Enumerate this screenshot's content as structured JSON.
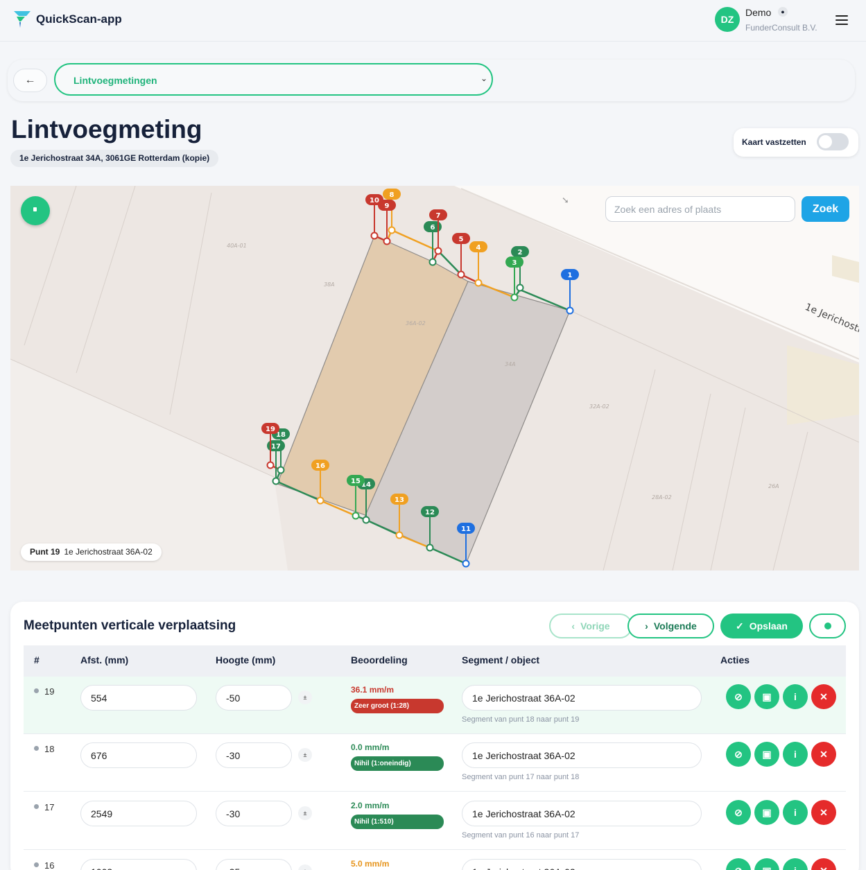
{
  "header": {
    "app_title": "QuickScan-app",
    "avatar_initials": "DZ",
    "user_name": "Demo",
    "user_org": "FunderConsult B.V."
  },
  "nav": {
    "back_label": "←",
    "selected_option": "Lintvoegmetingen"
  },
  "page": {
    "title": "Lintvoegmeting",
    "address": "1e Jerichostraat 34A, 3061GE Rotterdam (kopie)",
    "lock_map_label": "Kaart vastzetten",
    "lock_map_on": false
  },
  "map": {
    "search_placeholder": "Zoek een adres of plaats",
    "search_button": "Zoek",
    "street_label": "1e Jerichostr",
    "parcels": [
      "40A-01",
      "38A",
      "36A-02",
      "34A",
      "32A-02",
      "28A-02",
      "26A"
    ],
    "markers": [
      "1",
      "2",
      "3",
      "4",
      "5",
      "6",
      "7",
      "8",
      "9",
      "10",
      "11",
      "12",
      "13",
      "14",
      "15",
      "16",
      "17",
      "18",
      "19"
    ],
    "selected_point_label": "Punt 19",
    "selected_point_segment": "1e Jerichostraat 36A-02"
  },
  "panel": {
    "title": "Meetpunten verticale verplaatsing",
    "prev_label": "Vorige",
    "next_label": "Volgende",
    "save_label": "Opslaan",
    "columns": [
      "#",
      "Afst. (mm)",
      "Hoogte (mm)",
      "Beoordeling",
      "Segment / object",
      "Acties"
    ],
    "rows": [
      {
        "num": "19",
        "afst": "554",
        "hoogte": "-50",
        "pm": "±",
        "rate": "36.1 mm/m",
        "rate_color": "#c8382e",
        "badge": "Zeer groot (1:28)",
        "badge_color": "#c8382e",
        "segment": "1e Jerichostraat 36A-02",
        "note": "Segment van punt 18 naar punt 19"
      },
      {
        "num": "18",
        "afst": "676",
        "hoogte": "-30",
        "pm": "±",
        "rate": "0.0 mm/m",
        "rate_color": "#2b8a56",
        "badge": "Nihil (1:oneindig)",
        "badge_color": "#2b8a56",
        "segment": "1e Jerichostraat 36A-02",
        "note": "Segment van punt 17 naar punt 18"
      },
      {
        "num": "17",
        "afst": "2549",
        "hoogte": "-30",
        "pm": "±",
        "rate": "2.0 mm/m",
        "rate_color": "#2b8a56",
        "badge": "Nihil (1:510)",
        "badge_color": "#2b8a56",
        "segment": "1e Jerichostraat 36A-02",
        "note": "Segment van punt 16 naar punt 17"
      },
      {
        "num": "16",
        "afst": "1003",
        "hoogte": "-25",
        "pm": "±",
        "rate": "5.0 mm/m",
        "rate_color": "#e6941c",
        "badge": "",
        "badge_color": "#e6941c",
        "segment": "1e Jerichostraat 36A-02",
        "note": ""
      }
    ]
  }
}
